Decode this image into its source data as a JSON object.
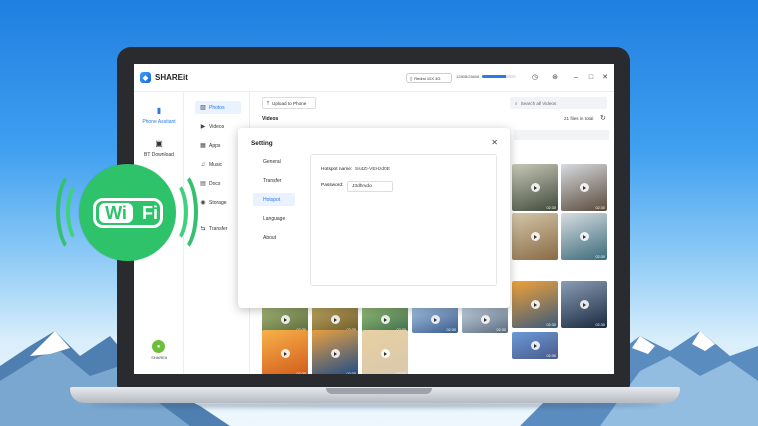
{
  "app": {
    "name": "SHAREit"
  },
  "titlebar": {
    "device": "Redmi 10X 4G",
    "storage": "12808/25608",
    "storage_fraction": 0.7
  },
  "sidebar": {
    "items": [
      {
        "label": "Phone Assitant",
        "icon": "phone-icon"
      },
      {
        "label": "BT Download",
        "icon": "bt-download-icon"
      }
    ],
    "bottom_label": "SHAREit"
  },
  "categories": [
    {
      "label": "Photos",
      "icon": "photo-icon"
    },
    {
      "label": "Videos",
      "icon": "video-icon"
    },
    {
      "label": "Apps",
      "icon": "apps-icon"
    },
    {
      "label": "Music",
      "icon": "music-icon"
    },
    {
      "label": "Docs",
      "icon": "docs-icon"
    },
    {
      "label": "Storage",
      "icon": "storage-icon"
    },
    {
      "label": "Transfer",
      "icon": "transfer-icon"
    }
  ],
  "main": {
    "upload_label": "Upload to Phone",
    "search_placeholder": "Search all Videos",
    "section_title": "Videos",
    "files_count": "21 files in total",
    "thumbs": [
      {
        "dur": "02:30",
        "color1": "#3f4a3a",
        "color2": "#c9c9b8"
      },
      {
        "dur": "02:30",
        "color1": "#5a4a3a",
        "color2": "#d7dbe1"
      },
      {
        "dur": "",
        "color1": "#8a6a45",
        "color2": "#d2c6a8"
      },
      {
        "dur": "02:30",
        "color1": "#3b6a7a",
        "color2": "#d8dde1"
      },
      {
        "dur": "02:30",
        "color1": "#3c5a7a",
        "color2": "#f0a23a"
      },
      {
        "dur": "02:30",
        "color1": "#1a2a40",
        "color2": "#8a9db5"
      },
      {
        "dur": "02:30",
        "color1": "#5a6a3a",
        "color2": "#a8b879"
      },
      {
        "dur": "02:30",
        "color1": "#6a5a2a",
        "color2": "#c2a860"
      },
      {
        "dur": "02:30",
        "color1": "#3a6a4a",
        "color2": "#9ac07a"
      },
      {
        "dur": "02:30",
        "color1": "#3a5a8a",
        "color2": "#a8c8e8"
      },
      {
        "dur": "02:30",
        "color1": "#5a6a7a",
        "color2": "#c8d8e8"
      },
      {
        "dur": "02:30",
        "color1": "#4a5a8a",
        "color2": "#6a9ad8"
      },
      {
        "dur": "02:30",
        "color1": "#d25a1a",
        "color2": "#f7b24a"
      },
      {
        "dur": "02:30",
        "color1": "#1a4a8a",
        "color2": "#e8a040"
      },
      {
        "dur": "02:30",
        "color1": "#d8c8b0",
        "color2": "#e8d0a0"
      }
    ]
  },
  "dialog": {
    "title": "Setting",
    "tabs": [
      "General",
      "Transfer",
      "Hotspot",
      "Language",
      "About"
    ],
    "active_tab": "Hotspot",
    "hotspot_name_label": "Hotspot name:",
    "hotspot_name_value": "Ss4ZI-VEHzd0E",
    "password_label": "Password:",
    "password_value": "J3dhrvdo"
  },
  "badge": {
    "wi": "Wi",
    "fi": "Fi"
  },
  "colors": {
    "accent": "#2a7be6",
    "wifi_green": "#2ec26b"
  }
}
